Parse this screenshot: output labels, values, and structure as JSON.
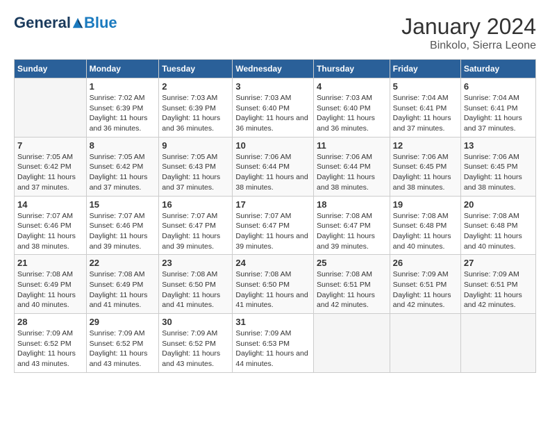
{
  "logo": {
    "general": "General",
    "blue": "Blue"
  },
  "title": "January 2024",
  "subtitle": "Binkolo, Sierra Leone",
  "days_of_week": [
    "Sunday",
    "Monday",
    "Tuesday",
    "Wednesday",
    "Thursday",
    "Friday",
    "Saturday"
  ],
  "weeks": [
    [
      {
        "day": "",
        "empty": true
      },
      {
        "day": "1",
        "sunrise": "Sunrise: 7:02 AM",
        "sunset": "Sunset: 6:39 PM",
        "daylight": "Daylight: 11 hours and 36 minutes."
      },
      {
        "day": "2",
        "sunrise": "Sunrise: 7:03 AM",
        "sunset": "Sunset: 6:39 PM",
        "daylight": "Daylight: 11 hours and 36 minutes."
      },
      {
        "day": "3",
        "sunrise": "Sunrise: 7:03 AM",
        "sunset": "Sunset: 6:40 PM",
        "daylight": "Daylight: 11 hours and 36 minutes."
      },
      {
        "day": "4",
        "sunrise": "Sunrise: 7:03 AM",
        "sunset": "Sunset: 6:40 PM",
        "daylight": "Daylight: 11 hours and 36 minutes."
      },
      {
        "day": "5",
        "sunrise": "Sunrise: 7:04 AM",
        "sunset": "Sunset: 6:41 PM",
        "daylight": "Daylight: 11 hours and 37 minutes."
      },
      {
        "day": "6",
        "sunrise": "Sunrise: 7:04 AM",
        "sunset": "Sunset: 6:41 PM",
        "daylight": "Daylight: 11 hours and 37 minutes."
      }
    ],
    [
      {
        "day": "7",
        "sunrise": "Sunrise: 7:05 AM",
        "sunset": "Sunset: 6:42 PM",
        "daylight": "Daylight: 11 hours and 37 minutes."
      },
      {
        "day": "8",
        "sunrise": "Sunrise: 7:05 AM",
        "sunset": "Sunset: 6:42 PM",
        "daylight": "Daylight: 11 hours and 37 minutes."
      },
      {
        "day": "9",
        "sunrise": "Sunrise: 7:05 AM",
        "sunset": "Sunset: 6:43 PM",
        "daylight": "Daylight: 11 hours and 37 minutes."
      },
      {
        "day": "10",
        "sunrise": "Sunrise: 7:06 AM",
        "sunset": "Sunset: 6:44 PM",
        "daylight": "Daylight: 11 hours and 38 minutes."
      },
      {
        "day": "11",
        "sunrise": "Sunrise: 7:06 AM",
        "sunset": "Sunset: 6:44 PM",
        "daylight": "Daylight: 11 hours and 38 minutes."
      },
      {
        "day": "12",
        "sunrise": "Sunrise: 7:06 AM",
        "sunset": "Sunset: 6:45 PM",
        "daylight": "Daylight: 11 hours and 38 minutes."
      },
      {
        "day": "13",
        "sunrise": "Sunrise: 7:06 AM",
        "sunset": "Sunset: 6:45 PM",
        "daylight": "Daylight: 11 hours and 38 minutes."
      }
    ],
    [
      {
        "day": "14",
        "sunrise": "Sunrise: 7:07 AM",
        "sunset": "Sunset: 6:46 PM",
        "daylight": "Daylight: 11 hours and 38 minutes."
      },
      {
        "day": "15",
        "sunrise": "Sunrise: 7:07 AM",
        "sunset": "Sunset: 6:46 PM",
        "daylight": "Daylight: 11 hours and 39 minutes."
      },
      {
        "day": "16",
        "sunrise": "Sunrise: 7:07 AM",
        "sunset": "Sunset: 6:47 PM",
        "daylight": "Daylight: 11 hours and 39 minutes."
      },
      {
        "day": "17",
        "sunrise": "Sunrise: 7:07 AM",
        "sunset": "Sunset: 6:47 PM",
        "daylight": "Daylight: 11 hours and 39 minutes."
      },
      {
        "day": "18",
        "sunrise": "Sunrise: 7:08 AM",
        "sunset": "Sunset: 6:47 PM",
        "daylight": "Daylight: 11 hours and 39 minutes."
      },
      {
        "day": "19",
        "sunrise": "Sunrise: 7:08 AM",
        "sunset": "Sunset: 6:48 PM",
        "daylight": "Daylight: 11 hours and 40 minutes."
      },
      {
        "day": "20",
        "sunrise": "Sunrise: 7:08 AM",
        "sunset": "Sunset: 6:48 PM",
        "daylight": "Daylight: 11 hours and 40 minutes."
      }
    ],
    [
      {
        "day": "21",
        "sunrise": "Sunrise: 7:08 AM",
        "sunset": "Sunset: 6:49 PM",
        "daylight": "Daylight: 11 hours and 40 minutes."
      },
      {
        "day": "22",
        "sunrise": "Sunrise: 7:08 AM",
        "sunset": "Sunset: 6:49 PM",
        "daylight": "Daylight: 11 hours and 41 minutes."
      },
      {
        "day": "23",
        "sunrise": "Sunrise: 7:08 AM",
        "sunset": "Sunset: 6:50 PM",
        "daylight": "Daylight: 11 hours and 41 minutes."
      },
      {
        "day": "24",
        "sunrise": "Sunrise: 7:08 AM",
        "sunset": "Sunset: 6:50 PM",
        "daylight": "Daylight: 11 hours and 41 minutes."
      },
      {
        "day": "25",
        "sunrise": "Sunrise: 7:08 AM",
        "sunset": "Sunset: 6:51 PM",
        "daylight": "Daylight: 11 hours and 42 minutes."
      },
      {
        "day": "26",
        "sunrise": "Sunrise: 7:09 AM",
        "sunset": "Sunset: 6:51 PM",
        "daylight": "Daylight: 11 hours and 42 minutes."
      },
      {
        "day": "27",
        "sunrise": "Sunrise: 7:09 AM",
        "sunset": "Sunset: 6:51 PM",
        "daylight": "Daylight: 11 hours and 42 minutes."
      }
    ],
    [
      {
        "day": "28",
        "sunrise": "Sunrise: 7:09 AM",
        "sunset": "Sunset: 6:52 PM",
        "daylight": "Daylight: 11 hours and 43 minutes."
      },
      {
        "day": "29",
        "sunrise": "Sunrise: 7:09 AM",
        "sunset": "Sunset: 6:52 PM",
        "daylight": "Daylight: 11 hours and 43 minutes."
      },
      {
        "day": "30",
        "sunrise": "Sunrise: 7:09 AM",
        "sunset": "Sunset: 6:52 PM",
        "daylight": "Daylight: 11 hours and 43 minutes."
      },
      {
        "day": "31",
        "sunrise": "Sunrise: 7:09 AM",
        "sunset": "Sunset: 6:53 PM",
        "daylight": "Daylight: 11 hours and 44 minutes."
      },
      {
        "day": "",
        "empty": true
      },
      {
        "day": "",
        "empty": true
      },
      {
        "day": "",
        "empty": true
      }
    ]
  ]
}
